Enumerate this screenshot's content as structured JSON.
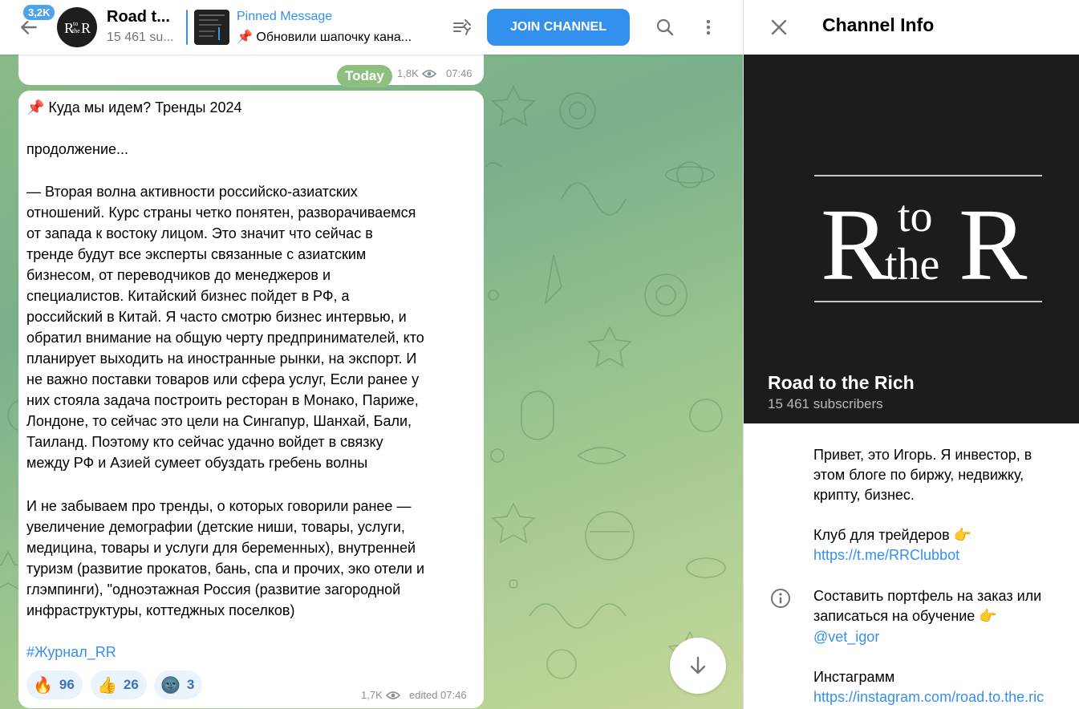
{
  "header": {
    "unread_count": "3,2K",
    "channel_title": "Road t...",
    "subscribers": "15 461 su...",
    "pinned_title": "Pinned Message",
    "pinned_text": "📌 Обновили шапочку кана...",
    "join_label": "JOIN CHANNEL"
  },
  "avatar": {
    "line1": "R",
    "line2": "to",
    "line3": "the",
    "line4": "R"
  },
  "previous_message": {
    "date_pill": "Today",
    "views": "1,8K",
    "time": "07:46"
  },
  "message": {
    "lines": [
      "📌 Куда мы идем? Тренды 2024",
      "",
      "продолжение...",
      "",
      "— Вторая волна активности российско-азиатских",
      "отношений. Курс страны четко понятен, разворачиваемся",
      "от запада к востоку лицом. Это значит что сейчас в",
      "тренде будут все эксперты связанные с азиатским",
      "бизнесом, от переводчиков до менеджеров и",
      "специалистов. Китайский бизнес пойдет в РФ, а",
      "российский в Китай. Я часто смотрю бизнес интервью, и",
      "обратил внимание на общую черту предпринимателей, кто",
      "планирует выходить на иностранные рынки, на экспорт. И",
      "не важно поставки товаров или сфера услуг, Если ранее у",
      "них стояла задача построить ресторан в Монако, Париже,",
      "Лондоне, то сейчас это цели на Сингапур, Шанхай, Бали,",
      "Таиланд. Поэтому кто сейчас удачно войдет в связку",
      "между РФ и Азией сумеет обуздать гребень волны",
      "",
      "И не забываем про тренды, о которых говорили ранее —",
      "увеличение демографии (детские ниши, товары, услуги,",
      "медицина, товары и услуги для беременных), внутренней",
      "туризм (развитие прокатов, бань, спа и прочих, эко отели и",
      "глэмпинги), \"одноэтажная Россия (развитие загородной",
      "инфраструктуры, коттеджных поселков)"
    ],
    "hashtag": "#Журнал_RR",
    "reactions": [
      {
        "emoji": "🔥",
        "count": "96"
      },
      {
        "emoji": "👍",
        "count": "26"
      },
      {
        "emoji": "🌚",
        "count": "3"
      }
    ],
    "views": "1,7K",
    "time": "edited 07:46"
  },
  "sidebar": {
    "title": "Channel Info",
    "cover_name": "Road to the Rich",
    "cover_subscribers": "15 461 subscribers",
    "logo": {
      "big1": "R",
      "small1": "to",
      "small2": "the",
      "big2": "R"
    },
    "bio_lines": [
      "Привет, это Игорь. Я инвестор, в",
      "этом блоге по биржу, недвижку,",
      "крипту, бизнес."
    ],
    "club_label": "Клуб для трейдеров 👉",
    "club_link": "https://t.me/RRClubbot",
    "order_line1": "Составить портфель на заказ или",
    "order_line2": "записаться на обучение 👉",
    "order_link": "@vet_igor",
    "insta_label": "Инстаграмм",
    "insta_link": "https://instagram.com/road.to.the.ric"
  },
  "colors": {
    "accent": "#3390ec",
    "chat_bg": "#8dbd86",
    "cover_bg": "#1c1c1c"
  }
}
